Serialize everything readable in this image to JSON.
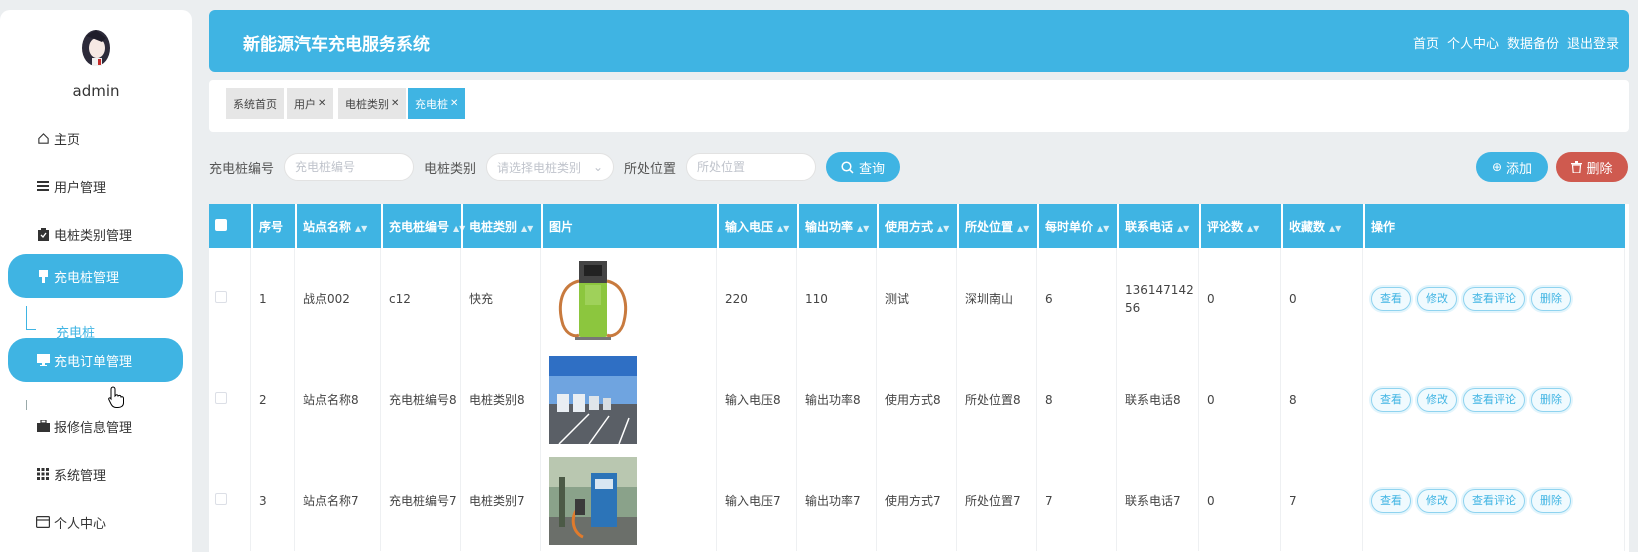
{
  "user": {
    "name": "admin"
  },
  "sidebar": {
    "items": [
      {
        "label": "主页",
        "icon": "home-icon"
      },
      {
        "label": "用户管理",
        "icon": "list-icon"
      },
      {
        "label": "电桩类别管理",
        "icon": "clipboard-icon"
      },
      {
        "label": "充电桩管理",
        "icon": "charger-icon"
      },
      {
        "label": "充电订单管理",
        "icon": "monitor-icon"
      },
      {
        "label": "报修信息管理",
        "icon": "briefcase-icon"
      },
      {
        "label": "系统管理",
        "icon": "grid-icon"
      },
      {
        "label": "个人中心",
        "icon": "id-card-icon"
      }
    ],
    "submenu": {
      "label": "充电桩"
    }
  },
  "header": {
    "title": "新能源汽车充电服务系统",
    "nav": [
      "首页",
      "个人中心",
      "数据备份",
      "退出登录"
    ]
  },
  "tabs": [
    {
      "label": "系统首页",
      "closable": false
    },
    {
      "label": "用户",
      "closable": true
    },
    {
      "label": "电桩类别",
      "closable": true
    },
    {
      "label": "充电桩",
      "closable": true,
      "active": true
    }
  ],
  "search": {
    "code_label": "充电桩编号",
    "code_placeholder": "充电桩编号",
    "type_label": "电桩类别",
    "type_placeholder": "请选择电桩类别",
    "location_label": "所处位置",
    "location_placeholder": "所处位置",
    "query_label": "查询",
    "add_label": "添加",
    "delete_label": "删除"
  },
  "table": {
    "columns": [
      "序号",
      "站点名称",
      "充电桩编号",
      "电桩类别",
      "图片",
      "输入电压",
      "输出功率",
      "使用方式",
      "所处位置",
      "每时单价",
      "联系电话",
      "评论数",
      "收藏数",
      "操作"
    ],
    "actions": [
      "查看",
      "修改",
      "查看评论",
      "删除"
    ],
    "rows": [
      {
        "index": "1",
        "station": "战点002",
        "code": "c12",
        "type": "快充",
        "image": "green-charging-pile",
        "voltage": "220",
        "power": "110",
        "usage": "测试",
        "location": "深圳南山",
        "price": "6",
        "phone": "13614714256",
        "comments": "0",
        "favorites": "0"
      },
      {
        "index": "2",
        "station": "站点名称8",
        "code": "充电桩编号8",
        "type": "电桩类别8",
        "image": "charging-station-lot",
        "voltage": "输入电压8",
        "power": "输出功率8",
        "usage": "使用方式8",
        "location": "所处位置8",
        "price": "8",
        "phone": "联系电话8",
        "comments": "0",
        "favorites": "8"
      },
      {
        "index": "3",
        "station": "站点名称7",
        "code": "充电桩编号7",
        "type": "电桩类别7",
        "image": "blue-charging-box",
        "voltage": "输入电压7",
        "power": "输出功率7",
        "usage": "使用方式7",
        "location": "所处位置7",
        "price": "7",
        "phone": "联系电话7",
        "comments": "0",
        "favorites": "7"
      }
    ]
  },
  "colors": {
    "primary": "#3fb4e3",
    "danger": "#cf5a4f",
    "background": "#ebeef0"
  }
}
